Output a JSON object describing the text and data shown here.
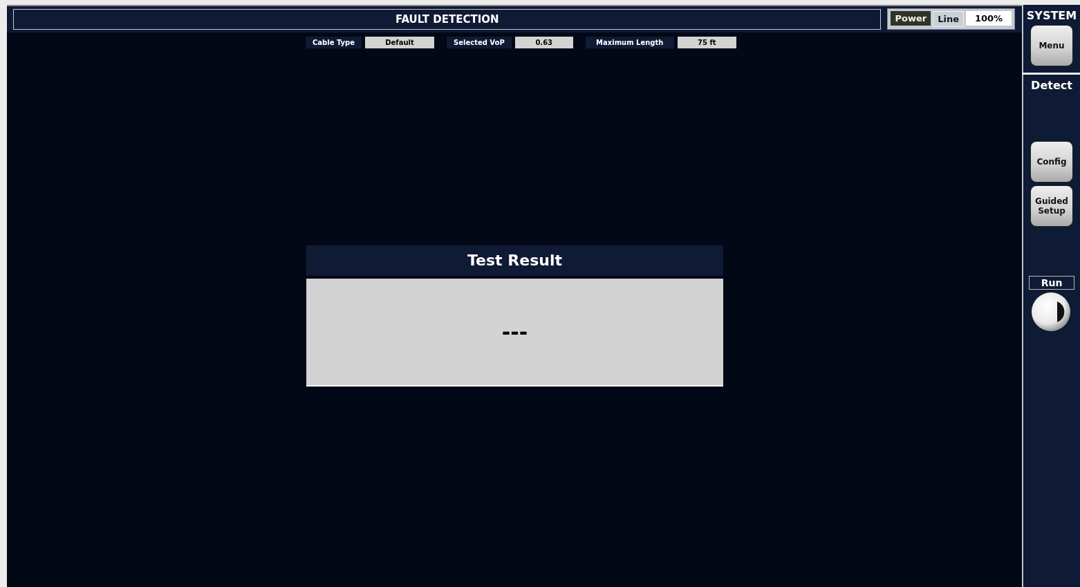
{
  "header": {
    "title": "FAULT DETECTION"
  },
  "status": {
    "power": "Power",
    "source": "Line",
    "battery": "100%"
  },
  "params": [
    {
      "label": "Cable Type",
      "value": "Default"
    },
    {
      "label": "Selected VoP",
      "value": "0.63"
    },
    {
      "label": "Maximum Length",
      "value": "75 ft"
    }
  ],
  "result": {
    "title": "Test Result",
    "value": "---"
  },
  "sidebar": {
    "system": {
      "title": "SYSTEM",
      "buttons": [
        "Menu"
      ]
    },
    "detect": {
      "title": "Detect",
      "buttons": [
        "Config",
        "Guided Setup"
      ]
    },
    "run": {
      "label": "Run"
    }
  }
}
